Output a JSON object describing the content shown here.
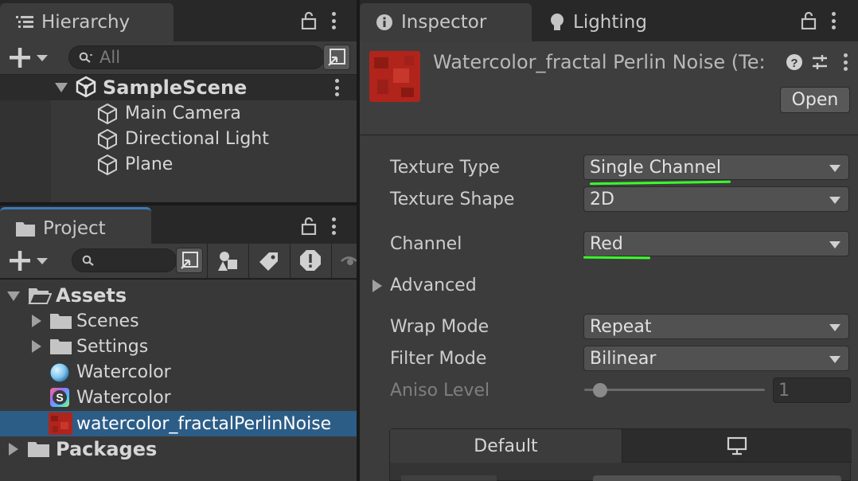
{
  "hierarchy": {
    "tab_label": "Hierarchy",
    "search_placeholder": "All",
    "items": [
      {
        "label": "SampleScene"
      },
      {
        "label": "Main Camera"
      },
      {
        "label": "Directional Light"
      },
      {
        "label": "Plane"
      }
    ]
  },
  "project": {
    "tab_label": "Project",
    "tree": [
      {
        "label": "Assets"
      },
      {
        "label": "Scenes"
      },
      {
        "label": "Settings"
      },
      {
        "label": "Watercolor"
      },
      {
        "label": "Watercolor"
      },
      {
        "label": "watercolor_fractalPerlinNoise"
      },
      {
        "label": "Packages"
      }
    ]
  },
  "inspector": {
    "tab_label": "Inspector",
    "lighting_tab_label": "Lighting",
    "asset_title": "Watercolor_fractal Perlin Noise (Te:",
    "open_label": "Open",
    "fields": {
      "texture_type": {
        "label": "Texture Type",
        "value": "Single Channel"
      },
      "texture_shape": {
        "label": "Texture Shape",
        "value": "2D"
      },
      "channel": {
        "label": "Channel",
        "value": "Red"
      },
      "advanced": {
        "label": "Advanced"
      },
      "wrap_mode": {
        "label": "Wrap Mode",
        "value": "Repeat"
      },
      "filter_mode": {
        "label": "Filter Mode",
        "value": "Bilinear"
      },
      "aniso_level": {
        "label": "Aniso Level",
        "value": "1"
      }
    },
    "platform_tab_default": "Default"
  },
  "colors": {
    "selection": "#2c5d87",
    "highlight_underline": "#3aff2a",
    "texture_red": "#b0241c"
  },
  "icons": [
    "hierarchy-list-icon",
    "lock-icon",
    "kebab-menu-icon",
    "plus-icon",
    "search-icon",
    "scene-unity-icon",
    "gameobject-cube-icon",
    "folder-icon",
    "info-icon",
    "lightbulb-icon",
    "help-icon",
    "settings-sliders-icon",
    "monitor-icon"
  ]
}
